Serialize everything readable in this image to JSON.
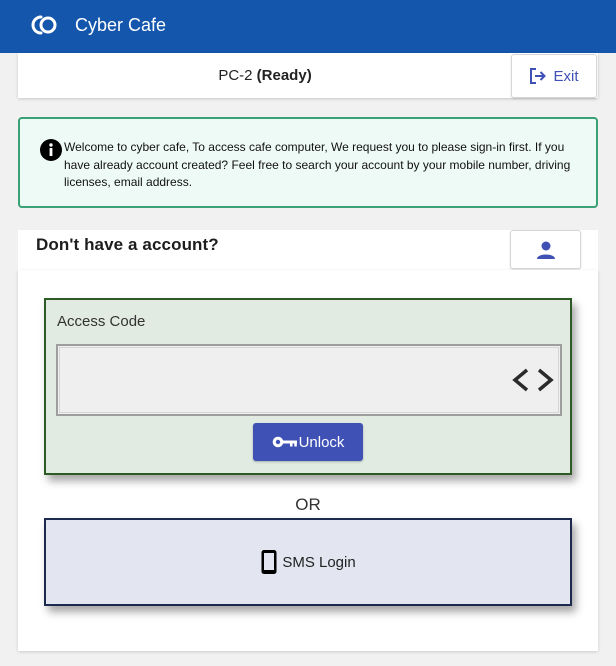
{
  "app": {
    "title": "Cyber Cafe",
    "logo_icon": "cafe-logo-icon"
  },
  "status": {
    "pc_name": "PC-2",
    "state": "(Ready)",
    "exit_label": "Exit",
    "exit_icon": "exit-icon"
  },
  "alert": {
    "icon": "info-icon",
    "message": "Welcome to cyber cafe, To access cafe computer, We request you to please sign-in first. If you have already account created? Feel free to search your account by your mobile number, driving licenses, email address."
  },
  "account": {
    "question": "Don't have a account?",
    "button_icon": "user-icon"
  },
  "access": {
    "label": "Access Code",
    "input_value": "",
    "input_icon": "code-icon",
    "unlock_label": "Unlock",
    "unlock_icon": "key-icon"
  },
  "or_label": "OR",
  "sms": {
    "label": "SMS Login",
    "icon": "mobile-phone-icon"
  },
  "colors": {
    "header": "#1556ad",
    "accent": "#3f51b5",
    "alert_border": "#3aa176",
    "access_border": "#2e5a25",
    "sms_border": "#1c2b4d"
  }
}
